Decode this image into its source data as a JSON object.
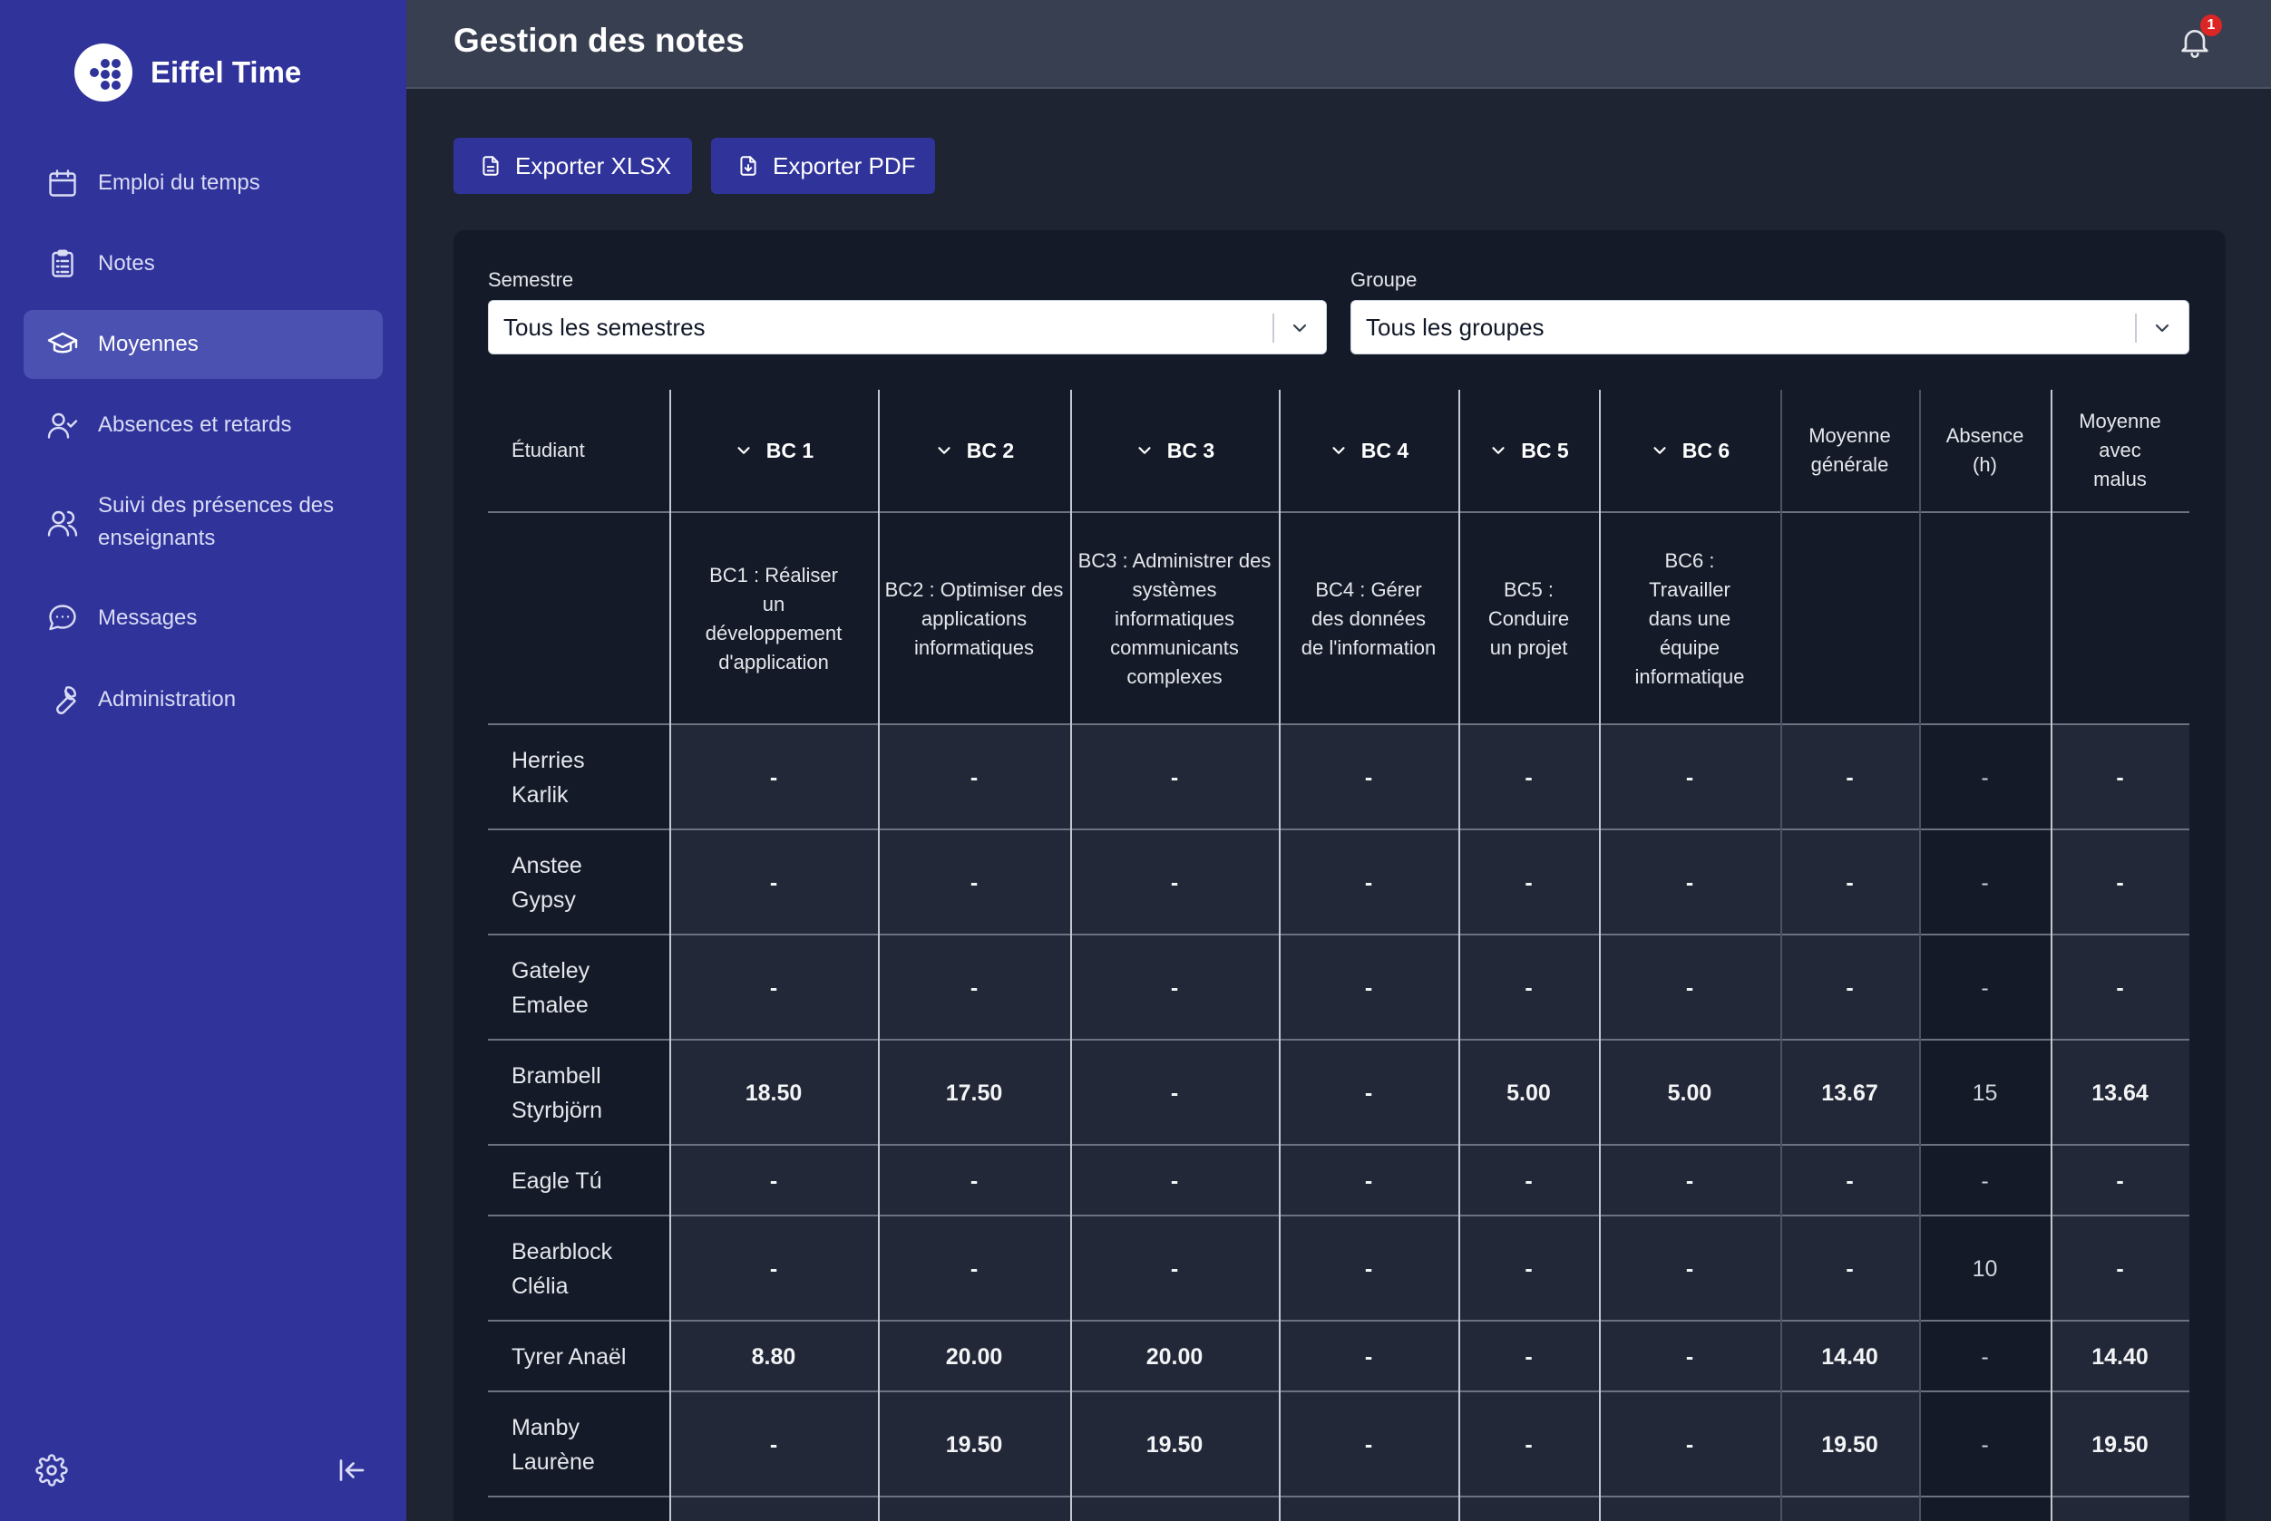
{
  "app": {
    "name": "Eiffel Time"
  },
  "sidebar": {
    "items": [
      {
        "label": "Emploi du temps",
        "icon": "calendar-icon",
        "active": false
      },
      {
        "label": "Notes",
        "icon": "clipboard-icon",
        "active": false
      },
      {
        "label": "Moyennes",
        "icon": "graduation-cap-icon",
        "active": true
      },
      {
        "label": "Absences et retards",
        "icon": "user-check-icon",
        "active": false
      },
      {
        "label": "Suivi des présences des enseignants",
        "icon": "users-icon",
        "active": false
      },
      {
        "label": "Messages",
        "icon": "message-icon",
        "active": false
      },
      {
        "label": "Administration",
        "icon": "wrench-icon",
        "active": false
      }
    ],
    "settings_icon": "gear-icon",
    "collapse_icon": "collapse-left-icon"
  },
  "header": {
    "title": "Gestion des notes",
    "notification_count": "1"
  },
  "toolbar": {
    "export_xlsx": "Exporter XLSX",
    "export_pdf": "Exporter PDF"
  },
  "filters": {
    "semestre_label": "Semestre",
    "semestre_value": "Tous les semestres",
    "groupe_label": "Groupe",
    "groupe_value": "Tous les groupes"
  },
  "table": {
    "columns": [
      {
        "header": "Étudiant",
        "description": ""
      },
      {
        "header": "BC 1",
        "description": "BC1 : Réaliser un développement d'application"
      },
      {
        "header": "BC 2",
        "description": "BC2 : Optimiser des applications informatiques"
      },
      {
        "header": "BC 3",
        "description": "BC3 : Administrer des systèmes informatiques communicants complexes"
      },
      {
        "header": "BC 4",
        "description": "BC4 : Gérer des données de l'information"
      },
      {
        "header": "BC 5",
        "description": "BC5 : Conduire un projet"
      },
      {
        "header": "BC 6",
        "description": "BC6 : Travailler dans une équipe informatique"
      },
      {
        "header": "Moyenne générale",
        "description": ""
      },
      {
        "header": "Absence (h)",
        "description": ""
      },
      {
        "header": "Moyenne avec malus",
        "description": ""
      }
    ],
    "rows": [
      {
        "name": "Herries Karlik",
        "values": [
          "-",
          "-",
          "-",
          "-",
          "-",
          "-",
          "-",
          "-",
          "-"
        ]
      },
      {
        "name": "Anstee Gypsy",
        "values": [
          "-",
          "-",
          "-",
          "-",
          "-",
          "-",
          "-",
          "-",
          "-"
        ]
      },
      {
        "name": "Gateley Emalee",
        "values": [
          "-",
          "-",
          "-",
          "-",
          "-",
          "-",
          "-",
          "-",
          "-"
        ]
      },
      {
        "name": "Brambell Styrbjörn",
        "values": [
          "18.50",
          "17.50",
          "-",
          "-",
          "5.00",
          "5.00",
          "13.67",
          "15",
          "13.64"
        ]
      },
      {
        "name": "Eagle Tú",
        "values": [
          "-",
          "-",
          "-",
          "-",
          "-",
          "-",
          "-",
          "-",
          "-"
        ]
      },
      {
        "name": "Bearblock Clélia",
        "values": [
          "-",
          "-",
          "-",
          "-",
          "-",
          "-",
          "-",
          "10",
          "-"
        ]
      },
      {
        "name": "Tyrer Anaël",
        "values": [
          "8.80",
          "20.00",
          "20.00",
          "-",
          "-",
          "-",
          "14.40",
          "-",
          "14.40"
        ]
      },
      {
        "name": "Manby Laurène",
        "values": [
          "-",
          "19.50",
          "19.50",
          "-",
          "-",
          "-",
          "19.50",
          "-",
          "19.50"
        ]
      }
    ]
  },
  "colors": {
    "sidebar": "#30339a",
    "sidebar_active": "#4a51b0",
    "header": "#383f51",
    "background": "#1f2433",
    "card": "#141a28",
    "badge": "#dc2626"
  }
}
